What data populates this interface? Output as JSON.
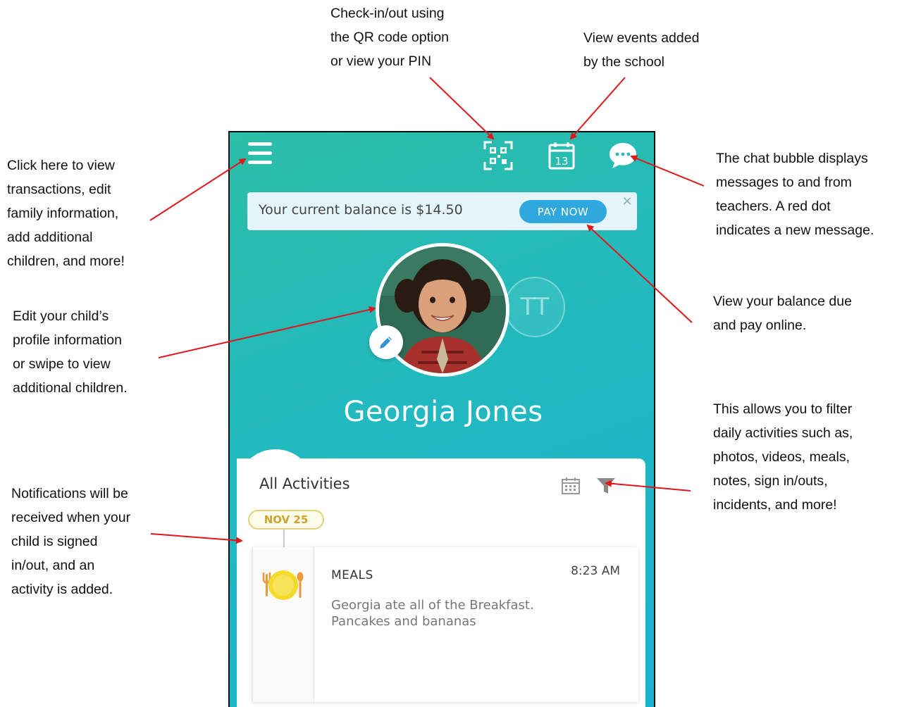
{
  "annotations": {
    "qr": "Check-in/out  using\nthe QR code option\nor view your PIN",
    "events": "View events added\nby the school",
    "menu": "Click here to view\ntransactions, edit\nfamily information,\nadd additional\nchildren, and more!",
    "chat": "The chat bubble displays\nmessages to and from\nteachers. A red dot\nindicates a new message.",
    "profile": "Edit your child’s\nprofile information\nor swipe to view\nadditional children.",
    "balance": "View your balance due\nand pay online.",
    "filter": "This allows you to filter\ndaily activities such as,\nphotos, videos, meals,\nnotes, sign in/outs,\nincidents, and more!",
    "notifications": "Notifications will be\nreceived when your\nchild is signed\nin/out, and an\nactivity is added."
  },
  "header": {
    "menu_icon": "hamburger-menu-icon",
    "qr_icon": "qr-code-icon",
    "calendar_icon": "calendar-icon",
    "calendar_day": "13",
    "chat_icon": "chat-bubble-icon"
  },
  "balance": {
    "text": "Your current balance is $14.50",
    "pay_label": "PAY NOW",
    "close_label": "×"
  },
  "profile": {
    "name": "Georgia Jones",
    "secondary_initials": "TT"
  },
  "activities": {
    "title": "All Activities",
    "date_badge": "NOV 25",
    "items": [
      {
        "type": "MEALS",
        "time": "8:23 AM",
        "description": "Georgia ate all of the Breakfast.\nPancakes and bananas"
      }
    ]
  },
  "colors": {
    "gradient_start": "#2bbea8",
    "gradient_end": "#19b3d2",
    "pay_button": "#2fa8df",
    "badge_text": "#c9a72d",
    "arrow": "#e0161b"
  }
}
